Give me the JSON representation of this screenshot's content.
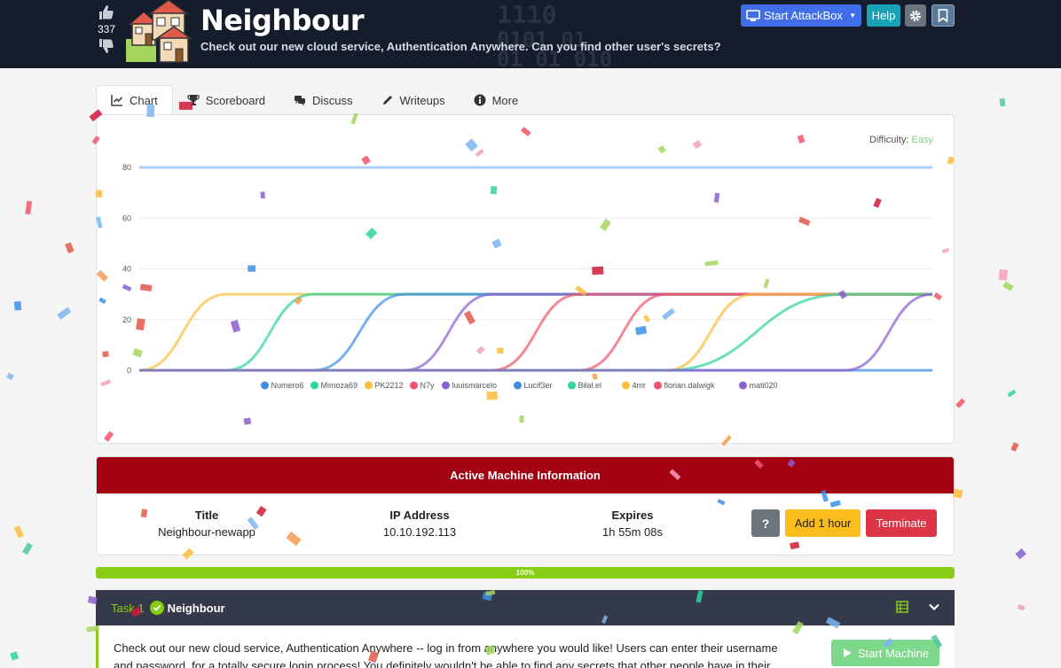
{
  "header": {
    "votes": "337",
    "title": "Neighbour",
    "subtitle": "Check out our new cloud service, Authentication Anywhere. Can you find other user's secrets?",
    "bg_digits": [
      "1110",
      "0101 01",
      "01 01 010"
    ],
    "buttons": {
      "attackbox": "Start AttackBox",
      "help": "Help"
    },
    "icons": [
      "thumbs-up-icon",
      "thumbs-down-icon",
      "houses-icon",
      "desktop-icon",
      "gear-icon",
      "bookmark-icon"
    ]
  },
  "tabs": [
    {
      "label": "Chart",
      "icon": "chart-icon"
    },
    {
      "label": "Scoreboard",
      "icon": "trophy-icon"
    },
    {
      "label": "Discuss",
      "icon": "comments-icon"
    },
    {
      "label": "Writeups",
      "icon": "pen-icon"
    },
    {
      "label": "More",
      "icon": "info-icon"
    }
  ],
  "difficulty": {
    "label": "Difficulty:",
    "value": "Easy",
    "color": "#7ed07b"
  },
  "chart_data": {
    "type": "line",
    "title": "",
    "xlabel": "",
    "ylabel": "",
    "ylim": [
      0,
      80
    ],
    "yticks": [
      0,
      20,
      40,
      60,
      80
    ],
    "grid": true,
    "legend_position": "bottom",
    "reference_line": {
      "value": 80,
      "color": "#a8cdf0"
    },
    "series": [
      {
        "name": "Numero6",
        "color": "#3d8ee6",
        "start": 0.0,
        "end": 0.0,
        "max": 30
      },
      {
        "name": "Mimoza69",
        "color": "#2ed39e",
        "start": 0.11,
        "end": 0.22,
        "max": 30
      },
      {
        "name": "PK2212",
        "color": "#fbbd3c",
        "start": 0.0,
        "end": 0.11,
        "max": 30
      },
      {
        "name": "N7y",
        "color": "#f0566a",
        "start": 0.445,
        "end": 0.555,
        "max": 30
      },
      {
        "name": "luuismarcelo",
        "color": "#8a5fd0",
        "start": 0.335,
        "end": 0.445,
        "max": 30
      },
      {
        "name": "Lucif3er",
        "color": "#3d8ee6",
        "start": 0.22,
        "end": 0.335,
        "max": 30
      },
      {
        "name": "Bilal.el",
        "color": "#2ed39e",
        "start": 0.665,
        "end": 0.89,
        "max": 30
      },
      {
        "name": "4mr",
        "color": "#fbbd3c",
        "start": 0.665,
        "end": 0.775,
        "max": 30
      },
      {
        "name": "florian.dalwigk",
        "color": "#f0566a",
        "start": 0.555,
        "end": 0.665,
        "max": 30
      },
      {
        "name": "mati020",
        "color": "#8a5fd0",
        "start": 0.89,
        "end": 1.0,
        "max": 30
      }
    ]
  },
  "machine": {
    "heading": "Active Machine Information",
    "title_label": "Title",
    "title_value": "Neighbour-newapp",
    "ip_label": "IP Address",
    "ip_value": "10.10.192.113",
    "expires_label": "Expires",
    "expires_value": "1h 55m 08s",
    "help_btn": "?",
    "add_btn": "Add 1 hour",
    "terminate_btn": "Terminate"
  },
  "progress": {
    "label": "100%",
    "value": 1.0
  },
  "task": {
    "number": "Task 1",
    "name": "Neighbour",
    "body": "Check out our new cloud service, Authentication Anywhere -- log in from anywhere you would like! Users can enter their username and password, for a totally secure login process! You definitely wouldn't be able to find any secrets that other people have in their profile, right?",
    "start_btn": "Start Machine"
  }
}
